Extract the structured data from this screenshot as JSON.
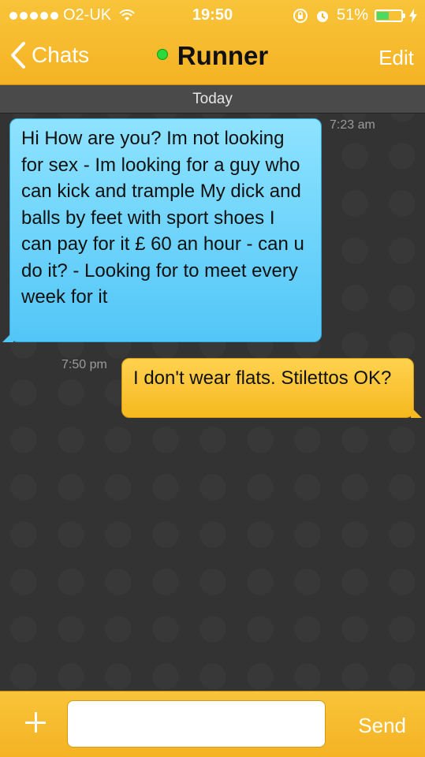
{
  "status_bar": {
    "carrier": "O2-UK",
    "time": "19:50",
    "battery": "51%"
  },
  "nav": {
    "back_label": "Chats",
    "title": "Runner",
    "edit_label": "Edit"
  },
  "chat": {
    "day_label": "Today",
    "messages": [
      {
        "time": "7:23 am",
        "text": "Hi How are you? Im not looking for sex - Im looking for a guy who can kick and trample My dick and balls by feet with sport shoes I can pay for it £ 60 an hour - can u do it? - Looking for to meet every week for it"
      },
      {
        "time": "7:50 pm",
        "text": "I don't wear flats. Stilettos OK?"
      }
    ]
  },
  "input": {
    "send_label": "Send"
  },
  "colors": {
    "header": "#f6b929",
    "incoming_bubble": "#5bcaf8",
    "outgoing_bubble": "#f9c12c",
    "online_dot": "#2bd93a"
  }
}
